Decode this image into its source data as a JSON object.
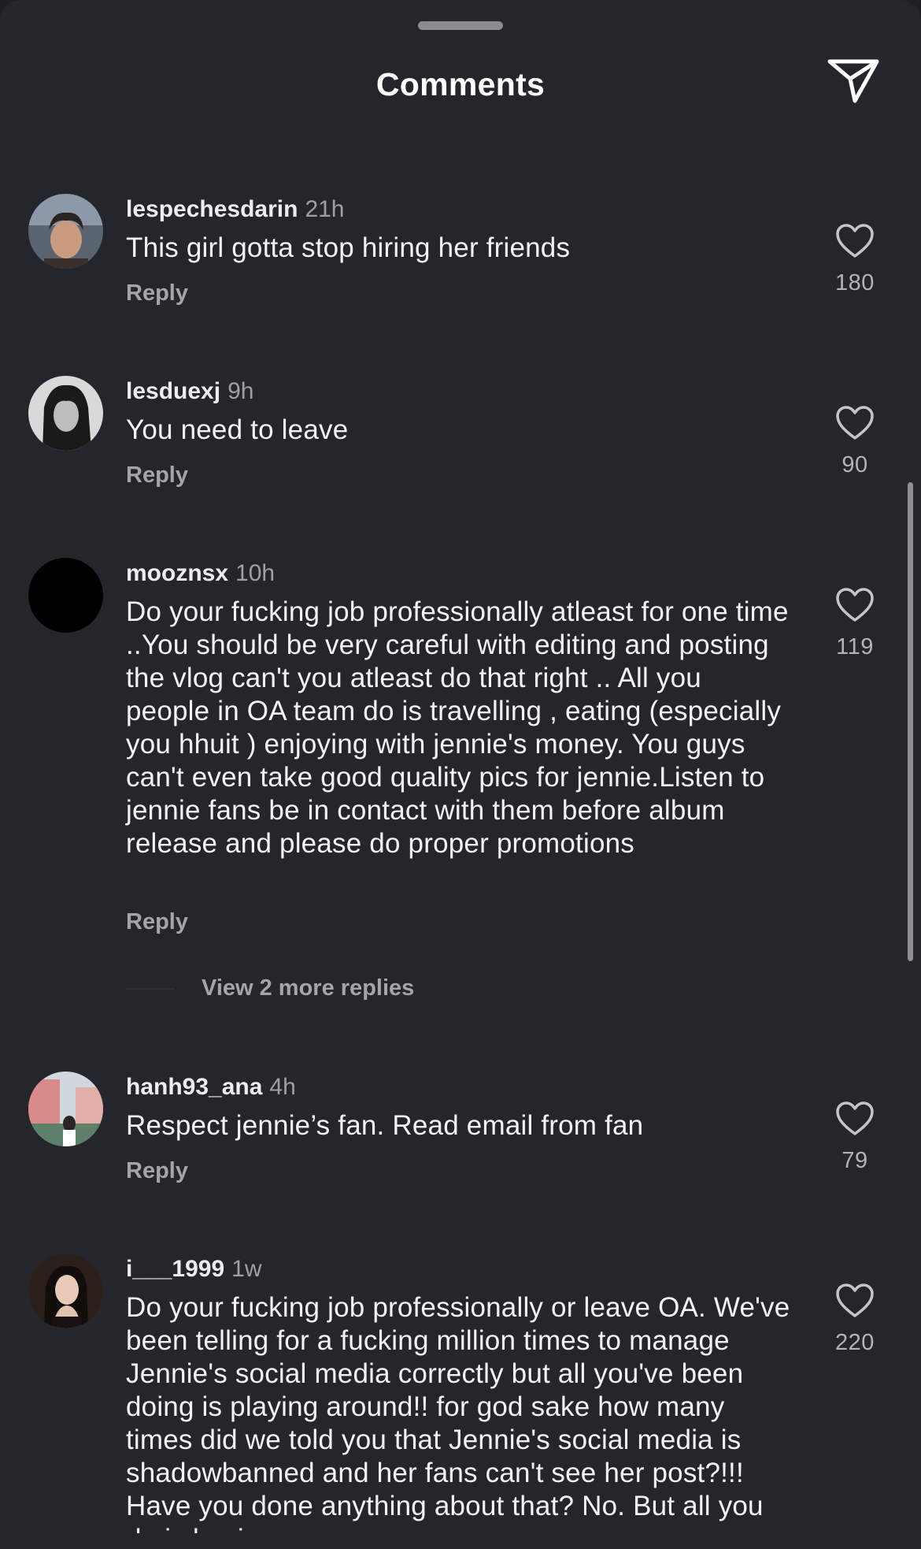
{
  "header": {
    "title": "Comments",
    "share_icon": "send-icon"
  },
  "comments": [
    {
      "username": "lespechesdarin",
      "time": "21h",
      "text": "This girl gotta stop hiring her friends",
      "reply_label": "Reply",
      "likes": "180"
    },
    {
      "username": "lesduexj",
      "time": "9h",
      "text": "You need to leave",
      "reply_label": "Reply",
      "likes": "90"
    },
    {
      "username": "mooznsx",
      "time": "10h",
      "text": "Do your fucking job professionally atleast for one time ..You should be very careful with editing and posting the vlog can't you atleast do that right .. All you people in OA team do is travelling , eating (especially you hhuit ) enjoying with jennie's money. You guys can't even take good quality pics for jennie.Listen to jennie fans be in contact with them before album release and please do proper promotions",
      "reply_label": "Reply",
      "likes": "119",
      "view_more": "View 2 more replies"
    },
    {
      "username": "hanh93_ana",
      "time": "4h",
      "text": "Respect jennie’s fan. Read email from fan",
      "reply_label": "Reply",
      "likes": "79"
    },
    {
      "username": "i___1999",
      "time": "1w",
      "text": "Do your fucking job professionally or leave OA. We've been telling for a fucking million times to manage Jennie's social media correctly but all you've been doing is playing around!! for god sake how many times did we told you that Jennie's social media is shadowbanned and her fans can't see her post?!!! Have you done anything about that? No. But all you do is hyping",
      "reply_label": "Reply",
      "likes": "220"
    }
  ],
  "colors": {
    "background": "#24262b",
    "text": "#f3f3f4",
    "muted": "#9ea0a6"
  }
}
